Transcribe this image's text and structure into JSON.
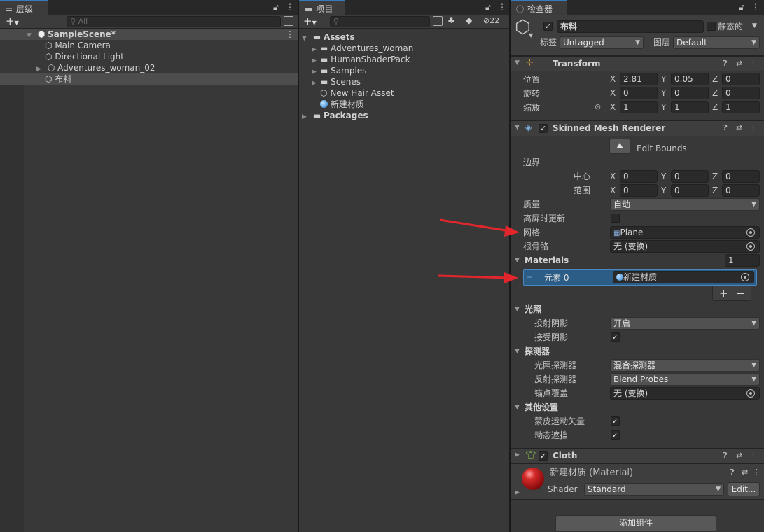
{
  "hierarchy": {
    "tab_label": "层级",
    "search_placeholder": "All",
    "scene_name": "SampleScene*",
    "items": [
      "Main Camera",
      "Directional Light",
      "Adventures_woman_02",
      "布料"
    ]
  },
  "project": {
    "tab_label": "项目",
    "hidden_count": "22",
    "assets_label": "Assets",
    "folders": [
      "Adventures_woman",
      "HumanShaderPack",
      "Samples",
      "Scenes"
    ],
    "files": [
      "New Hair Asset",
      "新建材质"
    ],
    "packages_label": "Packages"
  },
  "inspector": {
    "tab_label": "检查器",
    "object_name": "布料",
    "static_label": "静态的",
    "tag_label": "标签",
    "tag_value": "Untagged",
    "layer_label": "图层",
    "layer_value": "Default",
    "transform": {
      "title": "Transform",
      "position_label": "位置",
      "rotation_label": "旋转",
      "scale_label": "缩放",
      "position": [
        "2.81",
        "0.05",
        "0"
      ],
      "rotation": [
        "0",
        "0",
        "0"
      ],
      "scale": [
        "1",
        "1",
        "1"
      ],
      "axis_x": "X",
      "axis_y": "Y",
      "axis_z": "Z"
    },
    "smr": {
      "title": "Skinned Mesh Renderer",
      "edit_bounds": "Edit Bounds",
      "bounds_label": "边界",
      "center_label": "中心",
      "extent_label": "范围",
      "center": [
        "0",
        "0",
        "0"
      ],
      "extent": [
        "0",
        "0",
        "0"
      ],
      "quality_label": "质量",
      "quality_value": "自动",
      "offscreen_label": "离屏时更新",
      "mesh_label": "网格",
      "mesh_value": "Plane",
      "rootbone_label": "根骨骼",
      "rootbone_value": "无 (变换)",
      "materials_label": "Materials",
      "materials_count": "1",
      "element_label": "元素 0",
      "element_value": "新建材质",
      "plus": "+",
      "minus": "−",
      "lighting_label": "光照",
      "cast_shadows_label": "投射阴影",
      "cast_shadows_value": "开启",
      "receive_shadows_label": "接受阴影",
      "probes_label": "探测器",
      "light_probes_label": "光照探测器",
      "light_probes_value": "混合探测器",
      "reflection_probes_label": "反射探测器",
      "reflection_probes_value": "Blend Probes",
      "anchor_label": "锚点覆盖",
      "anchor_value": "无 (变换)",
      "other_label": "其他设置",
      "skinned_motion_label": "蒙皮运动矢量",
      "dynamic_occlusion_label": "动态遮挡"
    },
    "cloth_title": "Cloth",
    "material_title": "新建材质 (Material)",
    "shader_label": "Shader",
    "shader_value": "Standard",
    "edit_button": "Edit...",
    "add_component": "添加组件"
  },
  "colors": {
    "accent": "#3a79bb",
    "selection": "#2c5d87",
    "arrow": "#e3262b"
  }
}
